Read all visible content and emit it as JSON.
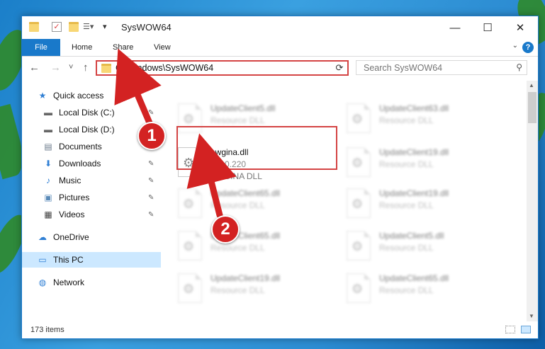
{
  "window": {
    "title": "SysWOW64",
    "minimize": "—",
    "maximize": "☐",
    "close": "✕"
  },
  "ribbon": {
    "tabs": [
      "File",
      "Home",
      "Share",
      "View"
    ],
    "help": "?"
  },
  "nav": {
    "back": "←",
    "forward": "→",
    "recent": "˅",
    "up": "↑",
    "address": "C:\\Windows\\SysWOW64",
    "address_dropdown": "˅",
    "refresh": "⟳",
    "search_placeholder": "Search SysWOW64",
    "search_icon": "⚲"
  },
  "sidebar": {
    "items": [
      {
        "label": "Quick access",
        "icon": "star-icon",
        "glyph": "★",
        "color": "#2f7fd4",
        "pinned": false
      },
      {
        "label": "Local Disk (C:)",
        "icon": "drive-icon",
        "glyph": "▬",
        "color": "#666666",
        "pinned": true
      },
      {
        "label": "Local Disk (D:)",
        "icon": "drive-icon",
        "glyph": "▬",
        "color": "#666666",
        "pinned": false
      },
      {
        "label": "Documents",
        "icon": "documents-icon",
        "glyph": "▤",
        "color": "#6a7a8a",
        "pinned": true
      },
      {
        "label": "Downloads",
        "icon": "downloads-icon",
        "glyph": "⬇",
        "color": "#2f7fd4",
        "pinned": true
      },
      {
        "label": "Music",
        "icon": "music-icon",
        "glyph": "♪",
        "color": "#2f7fd4",
        "pinned": true
      },
      {
        "label": "Pictures",
        "icon": "pictures-icon",
        "glyph": "▣",
        "color": "#5a8ab8",
        "pinned": true
      },
      {
        "label": "Videos",
        "icon": "videos-icon",
        "glyph": "▦",
        "color": "#444444",
        "pinned": true
      },
      {
        "label": "OneDrive",
        "icon": "onedrive-icon",
        "glyph": "☁",
        "color": "#2f7fd4",
        "pinned": false
      },
      {
        "label": "This PC",
        "icon": "this-pc-icon",
        "glyph": "▭",
        "color": "#2f7fd4",
        "pinned": false,
        "selected": true
      },
      {
        "label": "Network",
        "icon": "network-icon",
        "glyph": "◍",
        "color": "#2f7fd4",
        "pinned": false
      }
    ],
    "pin_glyph": "📌"
  },
  "files": {
    "focused": {
      "name": "awgina.dll",
      "version": "8.2.0.220",
      "description": "AWGINA  DLL"
    },
    "blurred_left": [
      {
        "name": "UpdateClient5.dll",
        "type": "Resource DLL"
      },
      {
        "name": "UpdateClient65.dll",
        "type": "Resource DLL"
      },
      {
        "name": "UpdateClient65.dll",
        "type": "Resource DLL"
      },
      {
        "name": "UpdateClient19.dll",
        "type": "Resource DLL"
      }
    ],
    "blurred_right": [
      {
        "name": "UpdateClient63.dll",
        "type": "Resource DLL"
      },
      {
        "name": "UpdateClient19.dll",
        "type": "Resource DLL"
      },
      {
        "name": "UpdateClient19.dll",
        "type": "Resource DLL"
      },
      {
        "name": "UpdateClient5.dll",
        "type": "Resource DLL"
      },
      {
        "name": "UpdateClient65.dll",
        "type": "Resource DLL"
      }
    ]
  },
  "status": {
    "item_count": "173 items"
  },
  "annotations": {
    "step1": "1",
    "step2": "2",
    "color": "#d32222"
  }
}
